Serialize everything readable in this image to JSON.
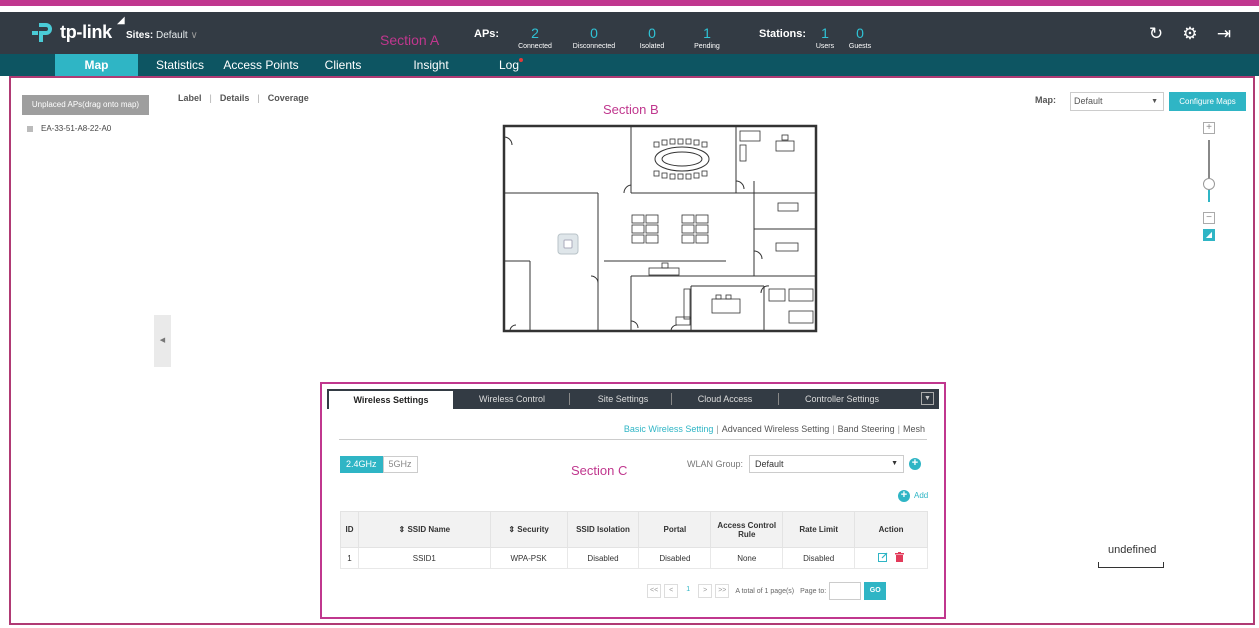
{
  "header": {
    "brand": "tp-link",
    "sites_label": "Sites:",
    "sites_value": "Default",
    "section_label": "Section A",
    "aps_label": "APs:",
    "ap_stats": [
      {
        "value": "2",
        "label": "Connected"
      },
      {
        "value": "0",
        "label": "Disconnected"
      },
      {
        "value": "0",
        "label": "Isolated"
      },
      {
        "value": "1",
        "label": "Pending"
      }
    ],
    "stations_label": "Stations:",
    "station_stats": [
      {
        "value": "1",
        "label": "Users"
      },
      {
        "value": "0",
        "label": "Guests"
      }
    ],
    "icons": [
      "refresh-icon",
      "gear-icon",
      "logout-icon"
    ]
  },
  "nav": {
    "items": [
      "Map",
      "Statistics",
      "Access Points",
      "Clients",
      "Insight",
      "Log"
    ],
    "active": "Map"
  },
  "map_section": {
    "section_label": "Section B",
    "unplaced_button": "Unplaced APs(drag onto map)",
    "unplaced_ap": "EA-33-51-A8-22-A0",
    "view_tabs": [
      "Label",
      "Details",
      "Coverage"
    ],
    "map_label": "Map:",
    "map_select": "Default",
    "configure_button": "Configure Maps",
    "scale_label": "undefined"
  },
  "settings_panel": {
    "section_label": "Section C",
    "tabs": [
      "Wireless Settings",
      "Wireless Control",
      "Site Settings",
      "Cloud Access",
      "Controller Settings"
    ],
    "subtabs": [
      "Basic Wireless Setting",
      "Advanced Wireless Setting",
      "Band Steering",
      "Mesh"
    ],
    "bands": [
      "2.4GHz",
      "5GHz"
    ],
    "wlan_label": "WLAN Group:",
    "wlan_value": "Default",
    "add_label": "Add",
    "columns": [
      "ID",
      "⇕ SSID Name",
      "⇕ Security",
      "SSID Isolation",
      "Portal",
      "Access Control Rule",
      "Rate Limit",
      "Action"
    ],
    "rows": [
      [
        "1",
        "SSID1",
        "WPA-PSK",
        "Disabled",
        "Disabled",
        "None",
        "Disabled"
      ]
    ],
    "pager": {
      "first": "<<",
      "prev": "<",
      "current": "1",
      "next": ">",
      "last": ">>",
      "total_text": "A total of 1 page(s)",
      "page_to": "Page to:",
      "go": "GO"
    }
  },
  "colors": {
    "accent": "#2fb5c5",
    "header_bg": "#333b44",
    "nav_bg": "#0d5562",
    "annotation": "#c0378e",
    "delete": "#e23a5a"
  }
}
